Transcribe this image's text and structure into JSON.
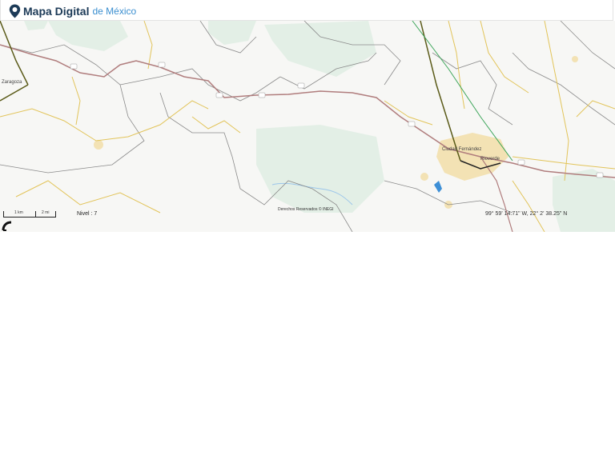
{
  "header": {
    "logo_main": "Mapa Digital",
    "logo_sub": "de México",
    "logo_icon": "map-pin-icon"
  },
  "map": {
    "place_labels": [
      "Zaragoza",
      "Ciudad Fernández",
      "Rioverde"
    ],
    "road_shields": [
      "70",
      "70",
      "70",
      "70",
      "70",
      "70",
      "70",
      "70"
    ],
    "scale": {
      "left": "1 km",
      "right": "2 mi"
    },
    "level_label": "Nivel : 7",
    "credits": "Derechos Reservados © INEGI",
    "coordinates": "99° 59' 14.71\" W, 22° 2' 38.25\" N",
    "rotate_icon": "compass-rotate-icon"
  },
  "colors": {
    "background": "#f7f7f5",
    "protected_area": "#e3efe6",
    "federal_highway": "#b07d7d",
    "roads": "#e2c45a",
    "boundaries": "#8a8a8a",
    "black_line": "#222222",
    "olive_line": "#5a5a18",
    "green_line": "#3da55a",
    "urban": "#f3e2b4",
    "water": "#3d8fd6",
    "brand_dark": "#1c3a57",
    "brand_blue": "#3b8fd0"
  }
}
